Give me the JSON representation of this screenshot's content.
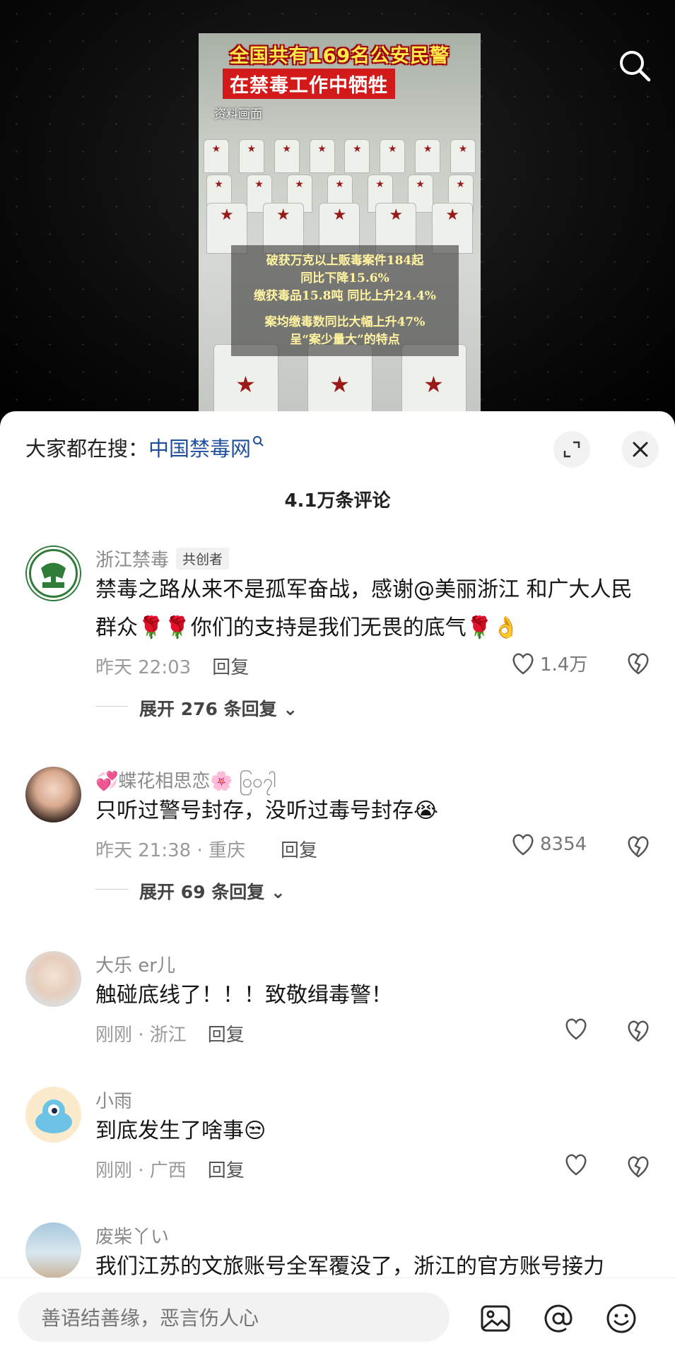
{
  "video": {
    "title_line1": "全国共有169名公安民警",
    "title_line2": "在禁毒工作中牺牲",
    "source_note": "资料画面",
    "stats": [
      "破获万克以上贩毒案件184起",
      "同比下降15.6%",
      "缴获毒品15.8吨 同比上升24.4%"
    ],
    "stats2": [
      "案均缴毒数同比大幅上升47%",
      "呈“案少量大”的特点"
    ]
  },
  "top": {
    "search_icon": "search-icon"
  },
  "sheet": {
    "hot_prefix": "大家都在搜：",
    "hot_keyword": "中国禁毒网",
    "comment_count": "4.1万条评论",
    "accent_color": "#1f4f9c"
  },
  "comments": [
    {
      "user": "浙江禁毒",
      "tag": "共创者",
      "text": "禁毒之路从来不是孤军奋战，感谢@美丽浙江 和广大人民群众🌹🌹你们的支持是我们无畏的底气🌹👌",
      "time": "昨天 22:03",
      "reply": "回复",
      "likes": "1.4万",
      "expand": "展开 276 条回复"
    },
    {
      "user": "💞蝶花相思恋🌸 ၀ြ၀၇ါ",
      "text": "只听过警号封存，没听过毒号封存😭",
      "time": "昨天 21:38 · 重庆",
      "reply": "回复",
      "likes": "8354",
      "expand": "展开 69 条回复"
    },
    {
      "user": "大乐 er儿",
      "text": "触碰底线了！！！致敬缉毒警！",
      "time": "刚刚 · 浙江",
      "reply": "回复"
    },
    {
      "user": "小雨",
      "text": "到底发生了啥事😒",
      "time": "刚刚 · 广西",
      "reply": "回复"
    },
    {
      "user": "废柴丫い",
      "text": "我们江苏的文旅账号全军覆没了，浙江的官方账号接力"
    }
  ],
  "input": {
    "placeholder": "善语结善缘，恶言伤人心"
  }
}
